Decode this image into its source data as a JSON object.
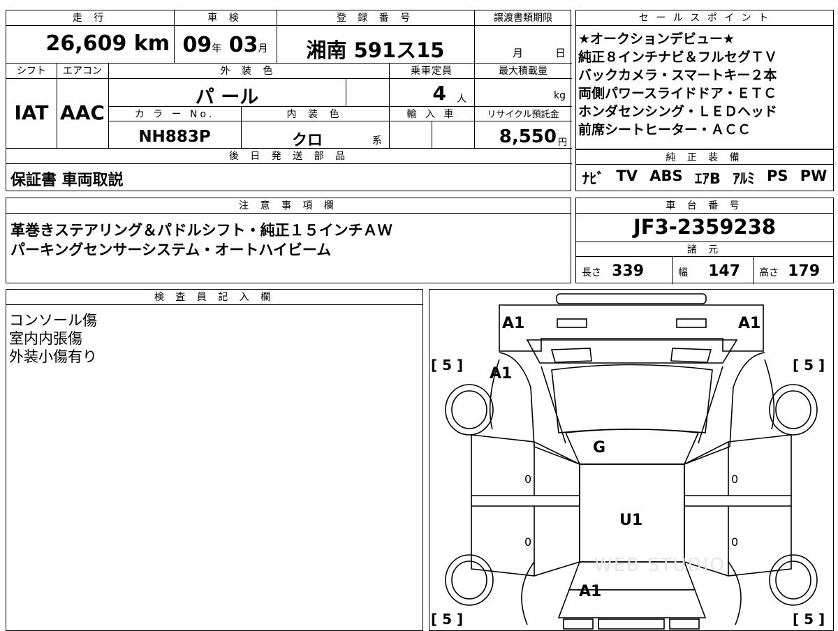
{
  "header": {
    "mileage_label": "走 行",
    "inspection_label": "車 検",
    "registration_label": "登 録 番 号",
    "transfer_deadline_label": "譲渡書類期限",
    "sales_points_label": "セ ー ル ス ポ イ ン ト"
  },
  "vehicle": {
    "mileage_value": "26,609",
    "mileage_unit": "km",
    "inspection_year": "09",
    "year_unit": "年",
    "inspection_month": "03",
    "month_unit": "月",
    "plate": "湘南 591ス15",
    "deadline_month_unit": "月",
    "deadline_day_unit": "日",
    "shift_label": "シフト",
    "aircon_label": "エアコン",
    "exterior_color_label": "外 装 色",
    "capacity_label": "乗車定員",
    "max_load_label": "最大積載量",
    "shift": "IAT",
    "aircon": "AAC",
    "exterior_color": "パ ール",
    "capacity": "4",
    "capacity_unit": "人",
    "load_unit": "kg",
    "color_no_label": "カ ラ ー No.",
    "interior_color_label": "内 装 色",
    "import_label": "輸 入 車",
    "recycle_label": "リサイクル預託金",
    "color_no": "NH883P",
    "interior_color": "クロ",
    "interior_suffix": "系",
    "recycle_fee": "8,550",
    "recycle_unit": "円",
    "later_parts_label": "後 日 発 送 部 品",
    "later_parts": "保証書 車両取説"
  },
  "sales_points": [
    "★オークションデビュー★",
    "純正８インチナビ＆フルセグＴＶ",
    "バックカメラ・スマートキー２本",
    "両側パワースライドドア・ＥＴＣ",
    "ホンダセンシング・ＬＥＤヘッド",
    "前席シートヒーター・ＡＣＣ"
  ],
  "equipment": {
    "label": "純 正 装 備",
    "items": [
      "ﾅﾋﾞ",
      "TV",
      "ABS",
      "ｴｱB",
      "ｱﾙﾐ",
      "PS",
      "PW"
    ]
  },
  "notes": {
    "label": "注 意 事 項 欄",
    "lines": [
      "革巻きステアリング＆パドルシフト・純正１５インチＡＷ",
      "パーキングセンサーシステム・オートハイビーム"
    ]
  },
  "chassis": {
    "label": "車 台 番 号",
    "value": "JF3-2359238",
    "specs_label": "諸 元",
    "length_label": "長さ",
    "length": "339",
    "width_label": "幅",
    "width": "147",
    "height_label": "高さ",
    "height": "179"
  },
  "inspector": {
    "label": "検 査 員 記 入 欄",
    "lines": [
      "コンソール傷",
      "室内内張傷",
      "外装小傷有り"
    ]
  },
  "diagram": {
    "marks": {
      "front_left": "A1",
      "front_right": "A1",
      "left_fender": "A1",
      "windshield": "G",
      "roof": "U1",
      "rear": "A1",
      "door_left": "0",
      "door_right": "0",
      "rear_door_left": "0",
      "rear_door_right": "0"
    },
    "tire_tl": "[ 5 ]",
    "tire_tr": "[ 5 ]",
    "tire_bl": "[ 5 ]",
    "tire_br": "[ 5 ]",
    "watermark": "WEB STUDIO"
  }
}
